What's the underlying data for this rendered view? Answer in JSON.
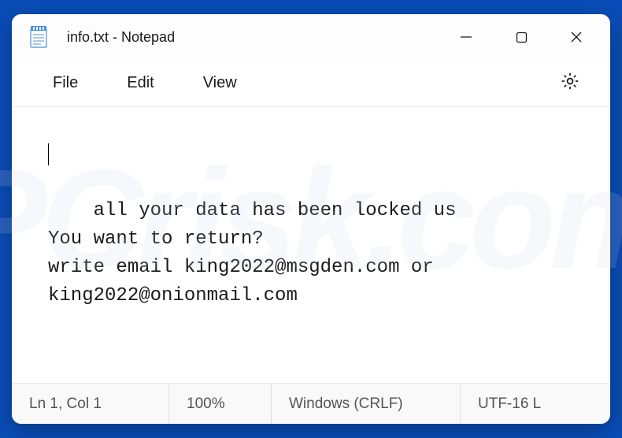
{
  "titlebar": {
    "title": "info.txt - Notepad"
  },
  "menu": {
    "file": "File",
    "edit": "Edit",
    "view": "View"
  },
  "content": {
    "text": "all your data has been locked us\nYou want to return?\nwrite email king2022@msgden.com or king2022@onionmail.com"
  },
  "statusbar": {
    "position": "Ln 1, Col 1",
    "zoom": "100%",
    "line_ending": "Windows (CRLF)",
    "encoding": "UTF-16 L"
  },
  "watermark": "PCrisk.com"
}
